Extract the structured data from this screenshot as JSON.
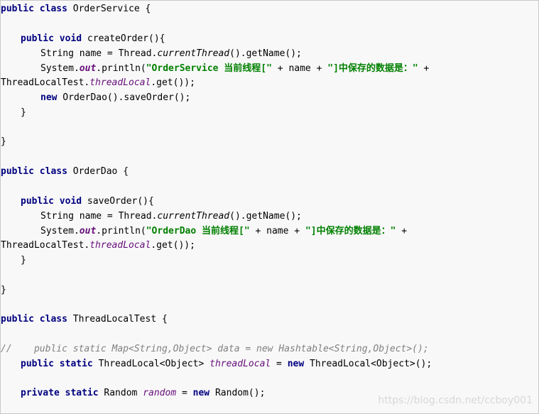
{
  "code": {
    "l01": {
      "kw1": "public class",
      "t1": " OrderService {"
    },
    "l02": {
      "kw1": "public void",
      "t1": " createOrder(){"
    },
    "l03": {
      "t1": "String name = Thread.",
      "i1": "currentThread",
      "t2": "().getName();"
    },
    "l04": {
      "t1": "System.",
      "f1": "out",
      "t2": ".println(",
      "s1": "\"OrderService 当前线程[\"",
      "t3": " + name + ",
      "s2": "\"]中保存的数据是：\"",
      "t4": " +"
    },
    "l05": {
      "t1": "ThreadLocalTest.",
      "f1": "threadLocal",
      "t2": ".get());"
    },
    "l06": {
      "kw1": "new",
      "t1": " OrderDao().saveOrder();"
    },
    "l07": {
      "t1": "}"
    },
    "l08": {
      "t1": "}"
    },
    "l09": {
      "kw1": "public class",
      "t1": " OrderDao {"
    },
    "l10": {
      "kw1": "public void",
      "t1": " saveOrder(){"
    },
    "l11": {
      "t1": "String name = Thread.",
      "i1": "currentThread",
      "t2": "().getName();"
    },
    "l12": {
      "t1": "System.",
      "f1": "out",
      "t2": ".println(",
      "s1": "\"OrderDao 当前线程[\"",
      "t3": " + name + ",
      "s2": "\"]中保存的数据是：\"",
      "t4": " +"
    },
    "l13": {
      "t1": "ThreadLocalTest.",
      "f1": "threadLocal",
      "t2": ".get());"
    },
    "l14": {
      "t1": "}"
    },
    "l15": {
      "t1": "}"
    },
    "l16": {
      "kw1": "public class",
      "t1": " ThreadLocalTest {"
    },
    "l17": {
      "c1": "//    public static Map<String,Object> data = new Hashtable<String,Object>();"
    },
    "l18": {
      "kw1": "public static",
      "t1": " ThreadLocal<Object> ",
      "f1": "threadLocal",
      "t2": " = ",
      "kw2": "new",
      "t3": " ThreadLocal<Object>();"
    },
    "l19": {
      "kw1": "private static",
      "t1": " Random ",
      "f1": "random",
      "t2": " = ",
      "kw2": "new",
      "t3": " Random();"
    }
  },
  "watermark": "https://blog.csdn.net/ccboy001"
}
